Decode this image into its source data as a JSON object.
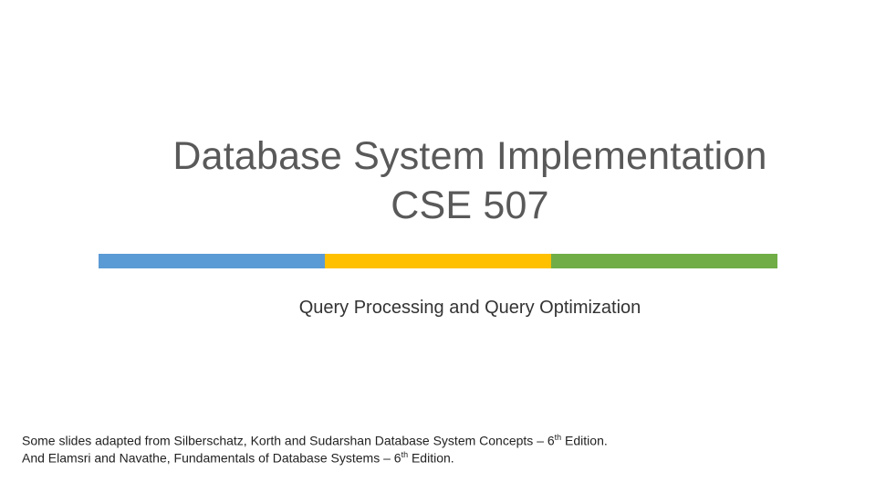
{
  "title": {
    "line1": "Database System Implementation",
    "line2": "CSE 507"
  },
  "colors": {
    "blue": "#5B9BD5",
    "yellow": "#FFC000",
    "green": "#70AD47"
  },
  "subtitle": "Query Processing and Query Optimization",
  "attribution": {
    "line1_a": "Some slides adapted from Silberschatz, Korth and Sudarshan Database System Concepts – 6",
    "line1_sup": "th",
    "line1_b": " Edition.",
    "line2_a": "And Elamsri and Navathe, Fundamentals of Database Systems – 6",
    "line2_sup": "th",
    "line2_b": " Edition."
  }
}
